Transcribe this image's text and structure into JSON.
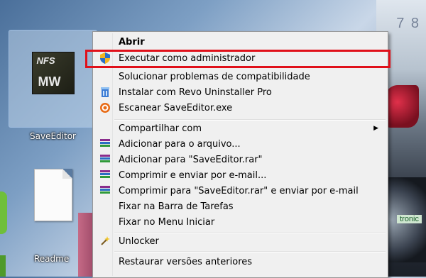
{
  "desktop": {
    "icons": [
      {
        "label": "SaveEditor",
        "thumb_top": "NFS",
        "thumb_bottom": "MW"
      },
      {
        "label": "Readme"
      }
    ],
    "background_text": "tronic",
    "background_numbers": "7 8"
  },
  "context_menu": {
    "items": [
      {
        "label": "Abrir",
        "icon": "",
        "bold": true
      },
      {
        "label": "Executar como administrador",
        "icon": "uac-shield-icon",
        "highlighted": true
      },
      {
        "label": "Solucionar problemas de compatibilidade",
        "icon": ""
      },
      {
        "label": "Instalar com Revo Uninstaller Pro",
        "icon": "revo-uninstaller-icon"
      },
      {
        "label": "Escanear SaveEditor.exe",
        "icon": "antivirus-scan-icon"
      },
      {
        "label": "Compartilhar com",
        "icon": "",
        "submenu": true
      },
      {
        "label": "Adicionar para o arquivo...",
        "icon": "winrar-icon"
      },
      {
        "label": "Adicionar para \"SaveEditor.rar\"",
        "icon": "winrar-icon"
      },
      {
        "label": "Comprimir e enviar por e-mail...",
        "icon": "winrar-icon"
      },
      {
        "label": "Comprimir para \"SaveEditor.rar\" e enviar por e-mail",
        "icon": "winrar-icon"
      },
      {
        "label": "Fixar na Barra de Tarefas",
        "icon": ""
      },
      {
        "label": "Fixar no Menu Iniciar",
        "icon": ""
      },
      {
        "label": "Unlocker",
        "icon": "unlocker-wand-icon"
      },
      {
        "label": "Restaurar versões anteriores",
        "icon": ""
      }
    ],
    "submenu_arrow": "▶"
  },
  "colors": {
    "highlight_border": "#e0101a",
    "menu_background": "#f0f0f0"
  }
}
